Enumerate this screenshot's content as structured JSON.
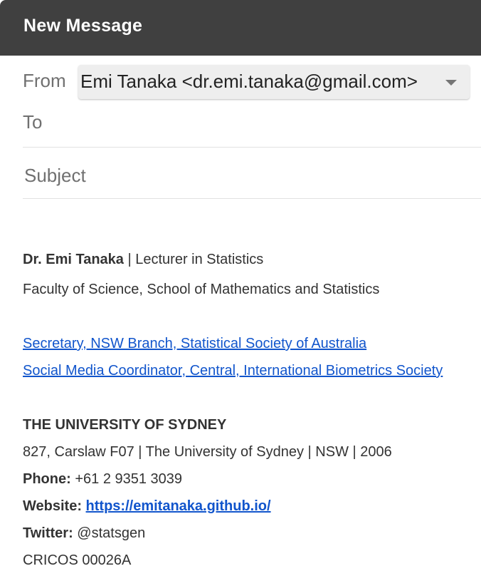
{
  "window": {
    "title": "New Message"
  },
  "header": {
    "from_label": "From",
    "from_value": "Emi Tanaka <dr.emi.tanaka@gmail.com>",
    "to_label": "To",
    "to_value": "",
    "subject_placeholder": "Subject",
    "subject_value": ""
  },
  "signature": {
    "name": "Dr. Emi Tanaka",
    "title_sep": " | ",
    "position": "Lecturer in Statistics",
    "faculty": "Faculty of Science, School of Mathematics and Statistics",
    "link1": "Secretary, NSW Branch, Statistical Society of Australia",
    "link2": "Social Media Coordinator, Central, International Biometrics Society ",
    "university": "THE UNIVERSITY OF SYDNEY",
    "address": "827, Carslaw F07 | The University of Sydney | NSW | 2006",
    "phone_label": "Phone:",
    "phone_value": " +61 2 9351 3039",
    "website_label": "Website:",
    "website_value": "https://emitanaka.github.io/",
    "twitter_label": "Twitter:",
    "twitter_value": " @statsgen",
    "cricos": "CRICOS 00026A"
  },
  "colors": {
    "titlebar": "#404040",
    "link": "#1155cc",
    "label": "#707070"
  },
  "icons": {
    "from_dropdown": "caret-down-icon"
  }
}
